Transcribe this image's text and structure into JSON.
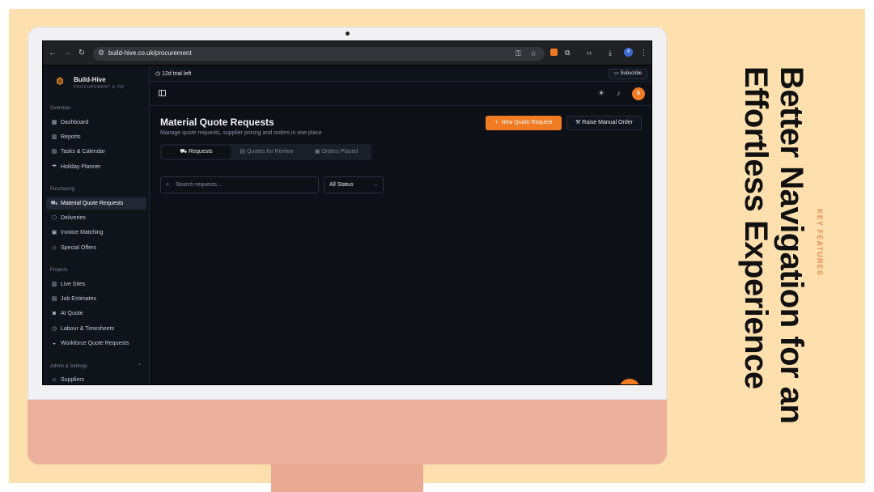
{
  "browser": {
    "url": "build-hive.co.uk/procurement",
    "profile_initial": "4"
  },
  "brand": {
    "name": "Build-Hive",
    "subtitle": "PROCUREMENT & PM"
  },
  "sidebar": {
    "sections": [
      {
        "label": "Overview",
        "items": [
          {
            "label": "Dashboard",
            "icon": "grid-icon"
          },
          {
            "label": "Reports",
            "icon": "chart-icon"
          },
          {
            "label": "Tasks & Calendar",
            "icon": "calendar-icon"
          },
          {
            "label": "Holiday Planner",
            "icon": "umbrella-icon"
          }
        ]
      },
      {
        "label": "Purchasing",
        "items": [
          {
            "label": "Material Quote Requests",
            "icon": "cart-icon",
            "active": true
          },
          {
            "label": "Deliveries",
            "icon": "package-icon"
          },
          {
            "label": "Invoice Matching",
            "icon": "invoice-icon"
          },
          {
            "label": "Special Offers",
            "icon": "tag-icon"
          }
        ]
      },
      {
        "label": "Projects",
        "items": [
          {
            "label": "Live Sites",
            "icon": "building-icon"
          },
          {
            "label": "Job Estimates",
            "icon": "estimate-icon"
          },
          {
            "label": "AI Quote",
            "icon": "camera-icon"
          },
          {
            "label": "Labour & Timesheets",
            "icon": "clock-icon"
          },
          {
            "label": "Workforce Quote Requests",
            "icon": "hardhat-icon"
          }
        ]
      },
      {
        "label": "Admin & Settings",
        "items": [
          {
            "label": "Suppliers",
            "icon": "users-icon"
          }
        ]
      }
    ]
  },
  "trial": {
    "text": "12d trial left",
    "subscribe_label": "Subscribe"
  },
  "user": {
    "avatar_initial": "D"
  },
  "page": {
    "title": "Material Quote Requests",
    "subtitle": "Manage quote requests, supplier pricing and orders in one place",
    "new_button": "New Quote Request",
    "manual_button": "Raise Manual Order"
  },
  "tabs": [
    {
      "label": "Requests",
      "active": true
    },
    {
      "label": "Quotes for Review",
      "active": false
    },
    {
      "label": "Orders Placed",
      "active": false
    }
  ],
  "filters": {
    "search_placeholder": "Search requests...",
    "status_value": "All Status"
  },
  "promo": {
    "kicker": "KEY FEATURES",
    "headline_line1": "Better Navigation for an",
    "headline_line2": "Effortless Experience"
  },
  "colors": {
    "accent": "#f07b22",
    "backdrop": "#fde0ae",
    "monitor": "#edb09c",
    "kicker": "#e88a57"
  }
}
